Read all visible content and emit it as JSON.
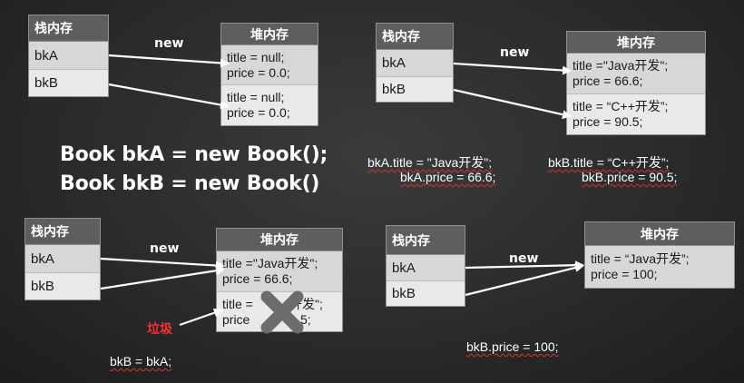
{
  "labels": {
    "stack": "栈内存",
    "heap": "堆内存",
    "new": "new",
    "bkA": "bkA",
    "bkB": "bkB",
    "garbage": "垃圾"
  },
  "panel1": {
    "heap_cells": [
      [
        "title = null;",
        "price = 0.0;"
      ],
      [
        "title = null;",
        "price = 0.0;"
      ]
    ]
  },
  "panel2": {
    "heap_cells": [
      [
        "title =\"Java开发\";",
        "price = 66.6;"
      ],
      [
        "title = “C++开发”;",
        "price = 90.5;"
      ]
    ],
    "code_a1": "bkA.title = \"Java开发\";",
    "code_a2": "bkA.price = 66.6;",
    "code_b1": "bkB.title = “C++开发”;",
    "code_b2": "bkB.price = 90.5;"
  },
  "big_code": {
    "line1": "Book bkA = new Book();",
    "line2": "Book bkB = new Book()"
  },
  "panel3": {
    "heap_cells": [
      [
        "title =\"Java开发\";",
        "price = 66.6;"
      ],
      [
        "title = ",
        "开发\";",
        "price",
        "5;"
      ]
    ],
    "assign": "bkB = bkA;"
  },
  "panel4": {
    "heap_cells": [
      [
        "title = “Java开发”;",
        "price = 100;"
      ]
    ],
    "assign": "bkB.price = 100;"
  },
  "icons": {
    "removed": "x-cross-icon"
  },
  "colors": {
    "header": "#5e5e5e",
    "cell_light": "#e9e9ea",
    "cell_alt": "#d7d7d8",
    "garbage": "#ff2d2d"
  }
}
